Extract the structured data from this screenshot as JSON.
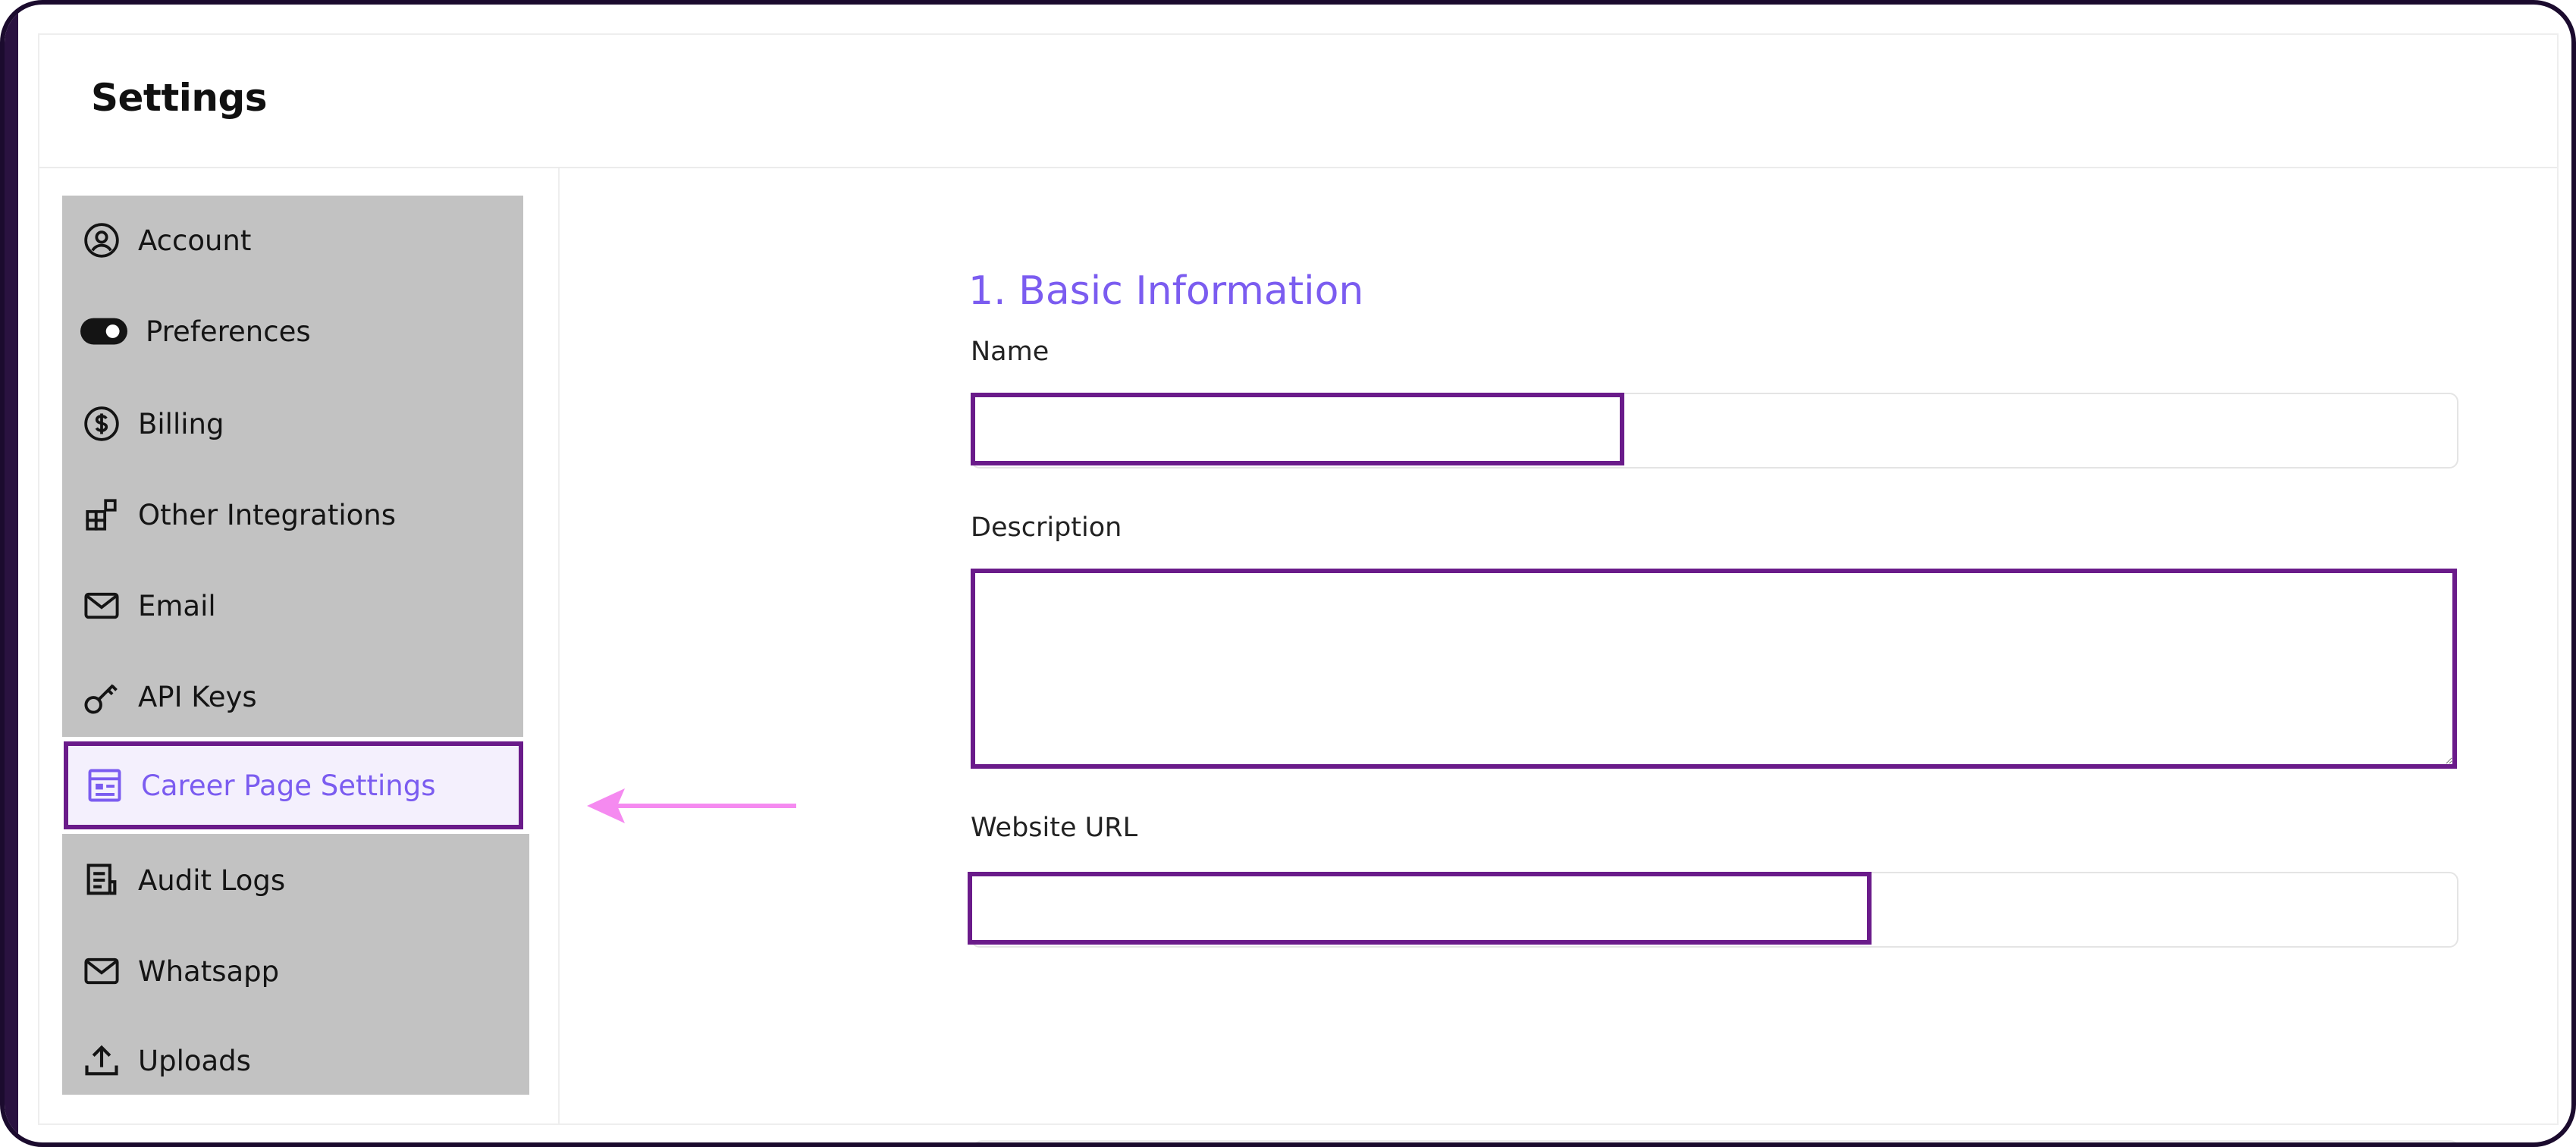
{
  "header": {
    "title": "Settings"
  },
  "sidebar": {
    "items": [
      {
        "label": "Account",
        "icon": "user-circle-icon"
      },
      {
        "label": "Preferences",
        "icon": "toggle-icon"
      },
      {
        "label": "Billing",
        "icon": "dollar-circle-icon"
      },
      {
        "label": "Other Integrations",
        "icon": "integrations-icon"
      },
      {
        "label": "Email",
        "icon": "mail-icon"
      },
      {
        "label": "API Keys",
        "icon": "key-icon"
      },
      {
        "label": "Career Page Settings",
        "icon": "layout-icon",
        "active": true
      },
      {
        "label": "Audit Logs",
        "icon": "document-icon"
      },
      {
        "label": "Whatsapp",
        "icon": "mail-icon"
      },
      {
        "label": "Uploads",
        "icon": "upload-icon"
      }
    ]
  },
  "main": {
    "section_title": "1. Basic Information",
    "fields": {
      "name": {
        "label": "Name",
        "value": "",
        "placeholder": ""
      },
      "description": {
        "label": "Description",
        "value": "",
        "placeholder": ""
      },
      "website": {
        "label": "Website URL",
        "value": "",
        "placeholder": ""
      }
    }
  },
  "colors": {
    "accent": "#7b5cf0",
    "highlight_border": "#6a1b8a",
    "arrow": "#f58af0",
    "sidebar_bg": "#c2c2c2"
  }
}
